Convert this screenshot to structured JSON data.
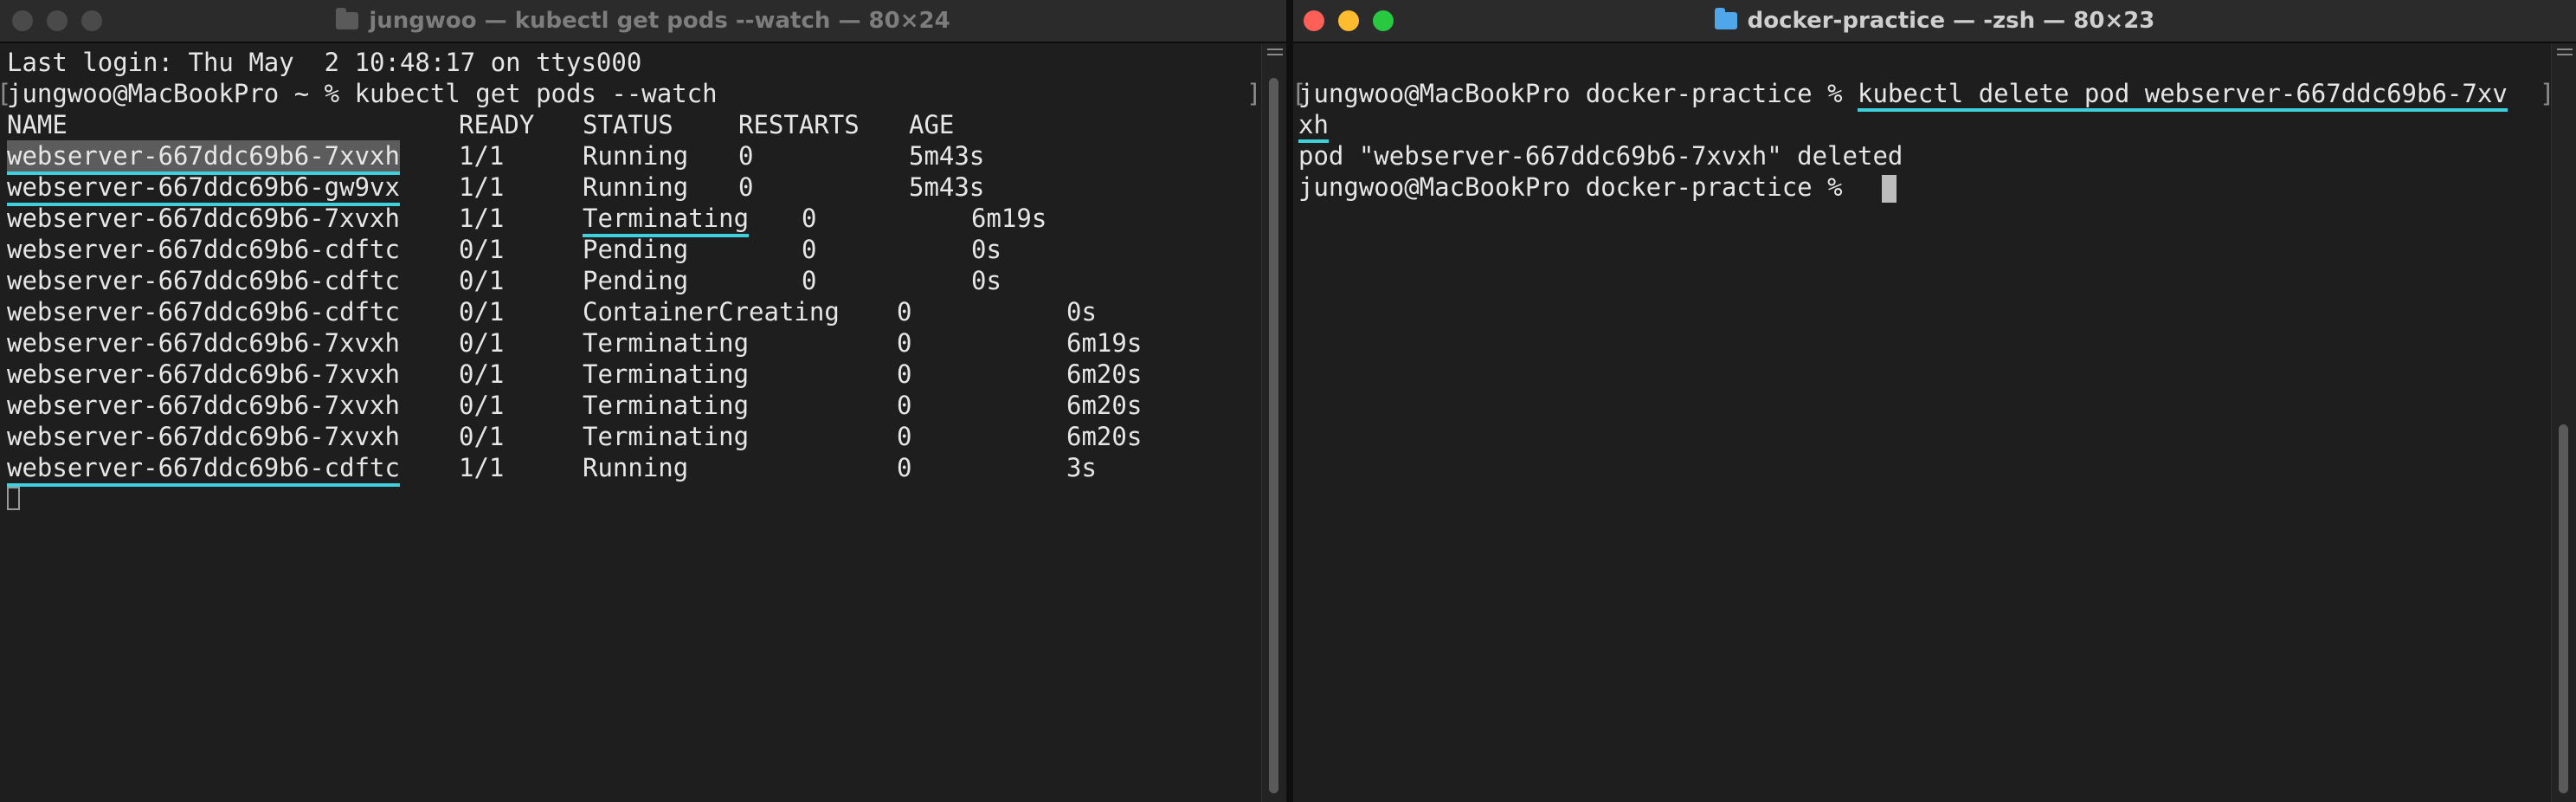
{
  "left": {
    "title": "jungwoo — kubectl get pods --watch — 80×24",
    "last_login": "Last login: Thu May  2 10:48:17 on ttys000",
    "prompt": "jungwoo@MacBookPro ~ % ",
    "command": "kubectl get pods --watch",
    "headers": [
      "NAME",
      "READY",
      "STATUS",
      "RESTARTS",
      "AGE"
    ],
    "rows": [
      {
        "name": "webserver-667ddc69b6-7xvxh",
        "ready": "1/1",
        "status": "Running",
        "restarts": "0",
        "age": "5m43s"
      },
      {
        "name": "webserver-667ddc69b6-gw9vx",
        "ready": "1/1",
        "status": "Running",
        "restarts": "0",
        "age": "5m43s"
      },
      {
        "name": "webserver-667ddc69b6-7xvxh",
        "ready": "1/1",
        "status": "Terminating",
        "restarts": "0",
        "age": "6m19s"
      },
      {
        "name": "webserver-667ddc69b6-cdftc",
        "ready": "0/1",
        "status": "Pending",
        "restarts": "0",
        "age": "0s"
      },
      {
        "name": "webserver-667ddc69b6-cdftc",
        "ready": "0/1",
        "status": "Pending",
        "restarts": "0",
        "age": "0s"
      },
      {
        "name": "webserver-667ddc69b6-cdftc",
        "ready": "0/1",
        "status": "ContainerCreating",
        "restarts": "0",
        "age": "0s"
      },
      {
        "name": "webserver-667ddc69b6-7xvxh",
        "ready": "0/1",
        "status": "Terminating",
        "restarts": "0",
        "age": "6m19s"
      },
      {
        "name": "webserver-667ddc69b6-7xvxh",
        "ready": "0/1",
        "status": "Terminating",
        "restarts": "0",
        "age": "6m20s"
      },
      {
        "name": "webserver-667ddc69b6-7xvxh",
        "ready": "0/1",
        "status": "Terminating",
        "restarts": "0",
        "age": "6m20s"
      },
      {
        "name": "webserver-667ddc69b6-7xvxh",
        "ready": "0/1",
        "status": "Terminating",
        "restarts": "0",
        "age": "6m20s"
      },
      {
        "name": "webserver-667ddc69b6-cdftc",
        "ready": "1/1",
        "status": "Running",
        "restarts": "0",
        "age": "3s"
      }
    ]
  },
  "right": {
    "title": "docker-practice — -zsh — 80×23",
    "prompt": "jungwoo@MacBookPro docker-practice % ",
    "command_line1": "kubectl delete pod webserver-667ddc69b6-7xv",
    "command_line2": "xh",
    "output": "pod \"webserver-667ddc69b6-7xvxh\" deleted",
    "prompt2": "jungwoo@MacBookPro docker-practice % "
  },
  "colors": {
    "traffic_red": "#fe5f57",
    "traffic_yellow": "#febc2e",
    "traffic_green": "#28c840",
    "inactive_light": "#4a4a4a",
    "underline": "#3fd0dc",
    "folder_left": "#5a5a5a",
    "folder_right": "#4fa6e8"
  },
  "icons": {
    "close": "close-icon",
    "minimize": "minimize-icon",
    "zoom": "zoom-icon",
    "folder": "folder-icon",
    "menu": "menu-icon"
  }
}
